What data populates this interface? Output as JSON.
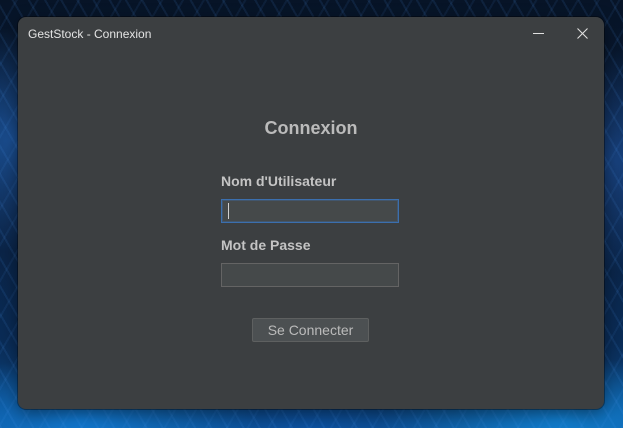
{
  "window": {
    "title": "GestStock - Connexion",
    "minimize_icon": "minimize-icon",
    "close_icon": "close-icon"
  },
  "form": {
    "heading": "Connexion",
    "username_label": "Nom d'Utilisateur",
    "username_value": "",
    "password_label": "Mot de Passe",
    "password_value": "",
    "submit_label": "Se Connecter"
  },
  "colors": {
    "window_background": "#3c3f41",
    "focus_border": "#3b6fae",
    "field_background": "#45494a",
    "button_background": "#4c5052"
  }
}
